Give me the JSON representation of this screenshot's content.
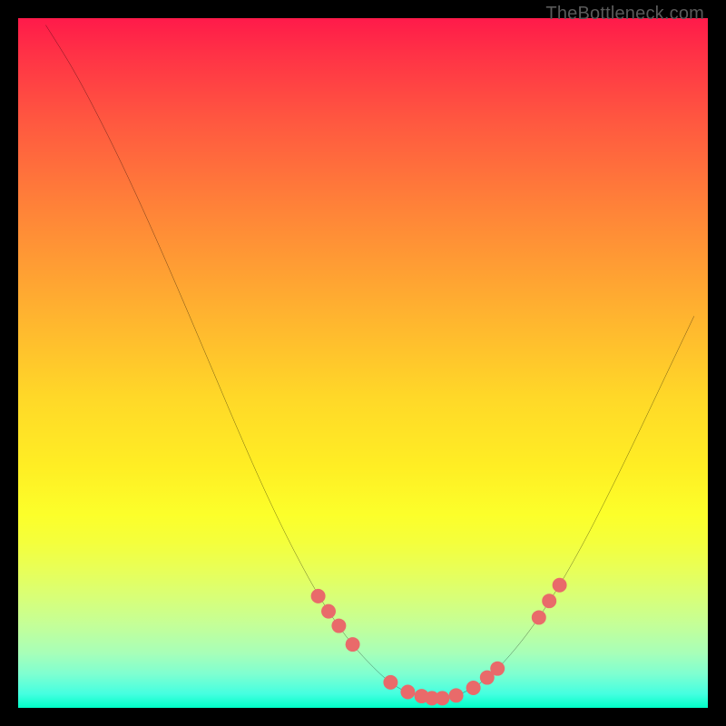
{
  "watermark": "TheBottleneck.com",
  "chart_data": {
    "type": "line",
    "title": "",
    "xlabel": "",
    "ylabel": "",
    "xlim": [
      0,
      100
    ],
    "ylim": [
      0,
      100
    ],
    "curve": {
      "name": "bottleneck-curve",
      "points": [
        {
          "x": 4.0,
          "y": 99.0
        },
        {
          "x": 8.0,
          "y": 92.5
        },
        {
          "x": 12.0,
          "y": 85.0
        },
        {
          "x": 16.0,
          "y": 76.8
        },
        {
          "x": 20.0,
          "y": 68.0
        },
        {
          "x": 24.0,
          "y": 58.8
        },
        {
          "x": 28.0,
          "y": 49.4
        },
        {
          "x": 32.0,
          "y": 40.0
        },
        {
          "x": 36.0,
          "y": 31.0
        },
        {
          "x": 40.0,
          "y": 22.8
        },
        {
          "x": 44.0,
          "y": 15.6
        },
        {
          "x": 48.0,
          "y": 9.8
        },
        {
          "x": 52.0,
          "y": 5.4
        },
        {
          "x": 55.0,
          "y": 3.0
        },
        {
          "x": 58.0,
          "y": 1.8
        },
        {
          "x": 61.0,
          "y": 1.4
        },
        {
          "x": 64.0,
          "y": 2.0
        },
        {
          "x": 67.0,
          "y": 3.6
        },
        {
          "x": 70.0,
          "y": 6.2
        },
        {
          "x": 74.0,
          "y": 11.0
        },
        {
          "x": 78.0,
          "y": 17.0
        },
        {
          "x": 82.0,
          "y": 24.0
        },
        {
          "x": 86.0,
          "y": 31.8
        },
        {
          "x": 90.0,
          "y": 40.0
        },
        {
          "x": 94.0,
          "y": 48.4
        },
        {
          "x": 98.0,
          "y": 56.8
        }
      ]
    },
    "markers": {
      "name": "highlight-dots",
      "color": "#e96a6a",
      "radius": 1.05,
      "points": [
        {
          "x": 43.5,
          "y": 16.2
        },
        {
          "x": 45.0,
          "y": 14.0
        },
        {
          "x": 46.5,
          "y": 11.9
        },
        {
          "x": 48.5,
          "y": 9.2
        },
        {
          "x": 54.0,
          "y": 3.7
        },
        {
          "x": 56.5,
          "y": 2.3
        },
        {
          "x": 58.5,
          "y": 1.7
        },
        {
          "x": 60.0,
          "y": 1.4
        },
        {
          "x": 61.5,
          "y": 1.4
        },
        {
          "x": 63.5,
          "y": 1.8
        },
        {
          "x": 66.0,
          "y": 2.9
        },
        {
          "x": 68.0,
          "y": 4.4
        },
        {
          "x": 69.5,
          "y": 5.7
        },
        {
          "x": 75.5,
          "y": 13.1
        },
        {
          "x": 77.0,
          "y": 15.5
        },
        {
          "x": 78.5,
          "y": 17.8
        }
      ]
    }
  }
}
